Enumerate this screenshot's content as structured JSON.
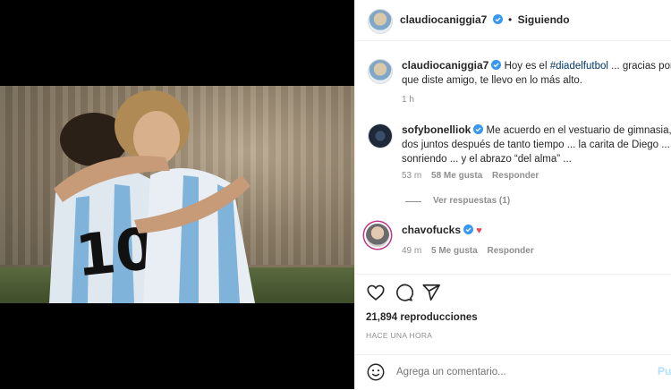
{
  "header": {
    "username": "claudiocaniggia7",
    "separator": "•",
    "follow_status": "Siguiendo"
  },
  "caption": {
    "username": "claudiocaniggia7",
    "text_before": "Hoy es el ",
    "hashtag": "#diadelfutbol",
    "text_after": " ... gracias por todo",
    "line2": "que diste amigo, te llevo en lo más alto.",
    "time": "1 h"
  },
  "comments": [
    {
      "username": "sofybonelliok",
      "line1": "Me acuerdo en el vestuario de gimnasia, los",
      "line2": "dos juntos después de tanto tiempo ... la carita de Diego ...",
      "line3": "sonriendo ... y el abrazo “del alma” ...",
      "time": "53 m",
      "likes": "58 Me gusta",
      "reply": "Responder",
      "view_replies": "Ver respuestas (1)"
    },
    {
      "username": "chavofucks",
      "time": "49 m",
      "likes": "5 Me gusta",
      "reply": "Responder"
    }
  ],
  "stats": {
    "views": "21,894 reproducciones",
    "posted": "HACE UNA HORA"
  },
  "comment_input": {
    "placeholder": "Agrega un comentario...",
    "publish": "Publicar"
  },
  "icons": [
    "heart-icon",
    "comment-icon",
    "share-icon",
    "emoji-icon",
    "verified-icon"
  ],
  "colors": {
    "link": "#00376b",
    "verified": "#3897f0",
    "publish": "#b2dffc",
    "heart": "#ed4956"
  }
}
